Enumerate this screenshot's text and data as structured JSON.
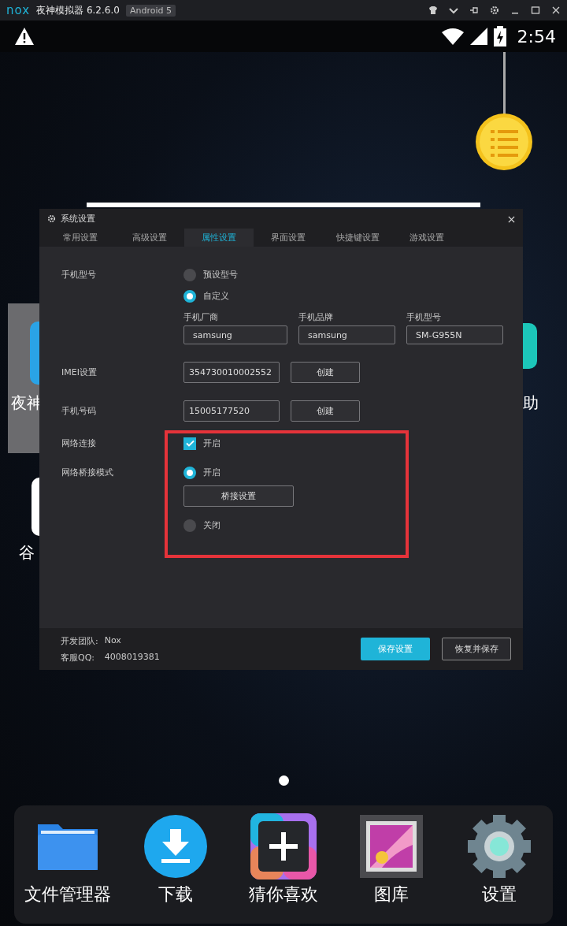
{
  "titlebar": {
    "logo": "nox",
    "title": "夜神模拟器 6.2.6.0",
    "badge": "Android 5"
  },
  "status_bar": {
    "time": "2:54"
  },
  "desktop": {
    "left_label": "夜神",
    "right_label": "助",
    "lower_label": "谷"
  },
  "dialog": {
    "title": "系统设置",
    "tabs": [
      {
        "label": "常用设置",
        "selected": false
      },
      {
        "label": "高级设置",
        "selected": false
      },
      {
        "label": "属性设置",
        "selected": true
      },
      {
        "label": "界面设置",
        "selected": false
      },
      {
        "label": "快捷键设置",
        "selected": false
      },
      {
        "label": "游戏设置",
        "selected": false
      }
    ],
    "model": {
      "label": "手机型号",
      "options": [
        {
          "label": "预设型号",
          "selected": false
        },
        {
          "label": "自定义",
          "selected": true
        }
      ],
      "fields": [
        {
          "label": "手机厂商",
          "value": "samsung"
        },
        {
          "label": "手机品牌",
          "value": "samsung"
        },
        {
          "label": "手机型号",
          "value": "SM-G955N"
        }
      ]
    },
    "imei": {
      "label": "IMEI设置",
      "value": "354730010002552",
      "button": "创建"
    },
    "phone": {
      "label": "手机号码",
      "value": "15005177520",
      "button": "创建"
    },
    "network": {
      "label": "网络连接",
      "option": {
        "label": "开启",
        "checked": true
      }
    },
    "bridge": {
      "label": "网络桥接模式",
      "options": [
        {
          "label": "开启",
          "selected": true
        },
        {
          "label": "关闭",
          "selected": false
        }
      ],
      "button": "桥接设置"
    },
    "footer": {
      "team_label": "开发团队:",
      "team": "Nox",
      "qq_label": "客服QQ:",
      "qq": "4008019381"
    },
    "buttons": [
      {
        "label": "保存设置",
        "kind": "primary"
      },
      {
        "label": "恢复并保存",
        "kind": "secondary"
      }
    ]
  },
  "dock": [
    {
      "label": "文件管理器",
      "kind": "folder"
    },
    {
      "label": "下载",
      "kind": "download"
    },
    {
      "label": "猜你喜欢",
      "kind": "plus"
    },
    {
      "label": "图库",
      "kind": "gallery"
    },
    {
      "label": "设置",
      "kind": "settings"
    }
  ]
}
